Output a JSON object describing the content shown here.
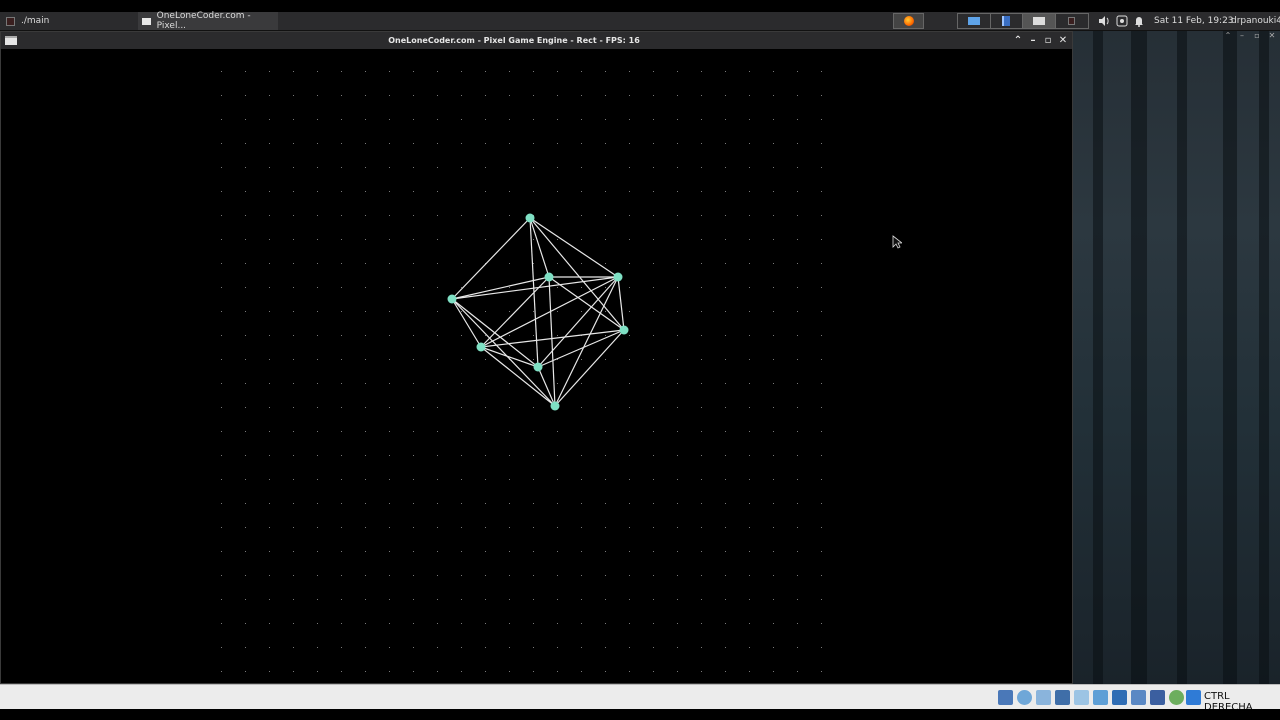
{
  "taskbar": {
    "tasks": [
      {
        "label": "./main"
      },
      {
        "label": "OneLoneCoder.com - Pixel..."
      }
    ],
    "workspaces": [
      "1",
      "2",
      "3",
      "4"
    ],
    "clock": "Sat 11 Feb, 19:23",
    "user": "drpanouki4"
  },
  "window": {
    "title": "OneLoneCoder.com - Pixel Game Engine - Rect - FPS: 16"
  },
  "statusbar": {
    "host_key_label": "CTRL DERECHA"
  },
  "scene": {
    "background": "#000000",
    "grid_dot_color": "#7a7a7a",
    "vertex_color": "#7fe0c4",
    "edge_color": "#e8e8e8",
    "vertex_count": 8,
    "shape": "wireframe cube"
  },
  "colors": {
    "panel": "#2b2b2d",
    "status_bar": "#ececec"
  }
}
